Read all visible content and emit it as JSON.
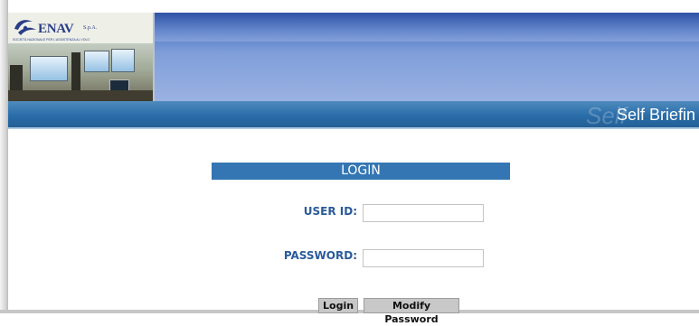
{
  "header": {
    "logo": {
      "name": "ENAV",
      "suffix": "S.p.A.",
      "tagline": "SOCIETÀ NAZIONALE PER L'ASSISTENZA AL VOLO"
    },
    "watermark": "Self",
    "brand_title": "Self Briefin"
  },
  "login": {
    "title": "LOGIN",
    "user_id_label": "USER ID:",
    "user_id_value": "",
    "password_label": "PASSWORD:",
    "password_value": "",
    "login_button": "Login",
    "modify_password_button": "Modify Password"
  },
  "colors": {
    "header_blue": "#5278c6",
    "bar_blue": "#2a6da9",
    "login_title_bg": "#3476b3",
    "label_color": "#2a5a9a"
  }
}
